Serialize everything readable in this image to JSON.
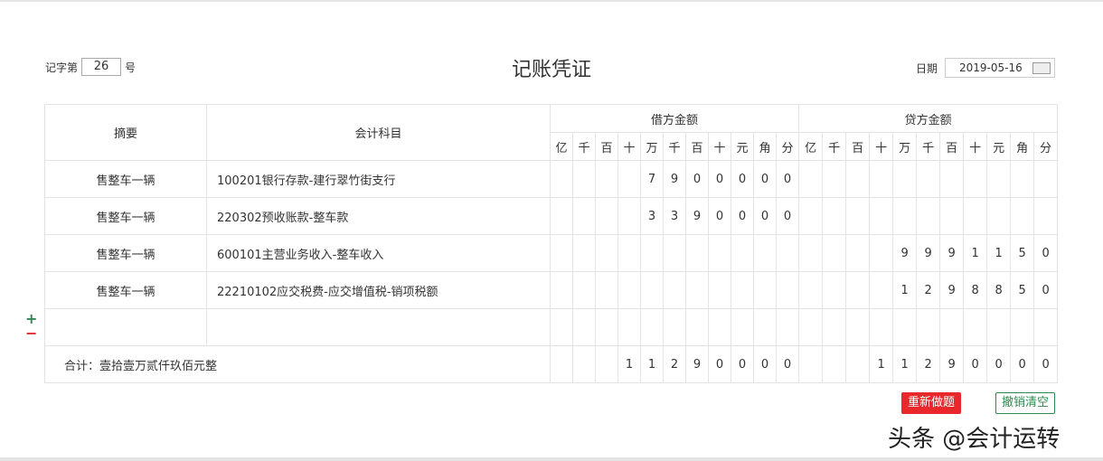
{
  "header": {
    "voucher_prefix": "记字第",
    "voucher_no": "26",
    "voucher_suffix": "号",
    "title": "记账凭证",
    "date_label": "日期",
    "date": "2019-05-16"
  },
  "columns": {
    "summary": "摘要",
    "account": "会计科目",
    "debit": "借方金额",
    "credit": "贷方金额",
    "units": [
      "亿",
      "千",
      "百",
      "十",
      "万",
      "千",
      "百",
      "十",
      "元",
      "角",
      "分"
    ]
  },
  "rows": [
    {
      "summary": "售整车一辆",
      "account": "100201银行存款-建行翠竹街支行",
      "debit": [
        "",
        "",
        "",
        "",
        "7",
        "9",
        "0",
        "0",
        "0",
        "0",
        "0"
      ],
      "credit": [
        "",
        "",
        "",
        "",
        "",
        "",
        "",
        "",
        "",
        "",
        ""
      ]
    },
    {
      "summary": "售整车一辆",
      "account": "220302预收账款-整车款",
      "debit": [
        "",
        "",
        "",
        "",
        "3",
        "3",
        "9",
        "0",
        "0",
        "0",
        "0"
      ],
      "credit": [
        "",
        "",
        "",
        "",
        "",
        "",
        "",
        "",
        "",
        "",
        ""
      ]
    },
    {
      "summary": "售整车一辆",
      "account": "600101主营业务收入-整车收入",
      "debit": [
        "",
        "",
        "",
        "",
        "",
        "",
        "",
        "",
        "",
        "",
        ""
      ],
      "credit": [
        "",
        "",
        "",
        "",
        "9",
        "9",
        "9",
        "1",
        "1",
        "5",
        "0"
      ]
    },
    {
      "summary": "售整车一辆",
      "account": "22210102应交税费-应交增值税-销项税额",
      "debit": [
        "",
        "",
        "",
        "",
        "",
        "",
        "",
        "",
        "",
        "",
        ""
      ],
      "credit": [
        "",
        "",
        "",
        "",
        "1",
        "2",
        "9",
        "8",
        "8",
        "5",
        "0"
      ]
    },
    {
      "summary": "",
      "account": "",
      "debit": [
        "",
        "",
        "",
        "",
        "",
        "",
        "",
        "",
        "",
        "",
        ""
      ],
      "credit": [
        "",
        "",
        "",
        "",
        "",
        "",
        "",
        "",
        "",
        "",
        ""
      ]
    }
  ],
  "total": {
    "label": "合计：壹拾壹万贰仟玖佰元整",
    "debit": [
      "",
      "",
      "",
      "1",
      "1",
      "2",
      "9",
      "0",
      "0",
      "0",
      "0"
    ],
    "credit": [
      "",
      "",
      "",
      "1",
      "1",
      "2",
      "9",
      "0",
      "0",
      "0",
      "0"
    ]
  },
  "controls": {
    "add": "+",
    "remove": "−",
    "redo": "重新做题",
    "clear": "撤销清空"
  },
  "watermark": "头条 @会计运转",
  "colors": {
    "redo": "#e8282b",
    "clear": "#2d8a4e",
    "plus": "#2d8a4e",
    "minus": "#e8282b"
  }
}
